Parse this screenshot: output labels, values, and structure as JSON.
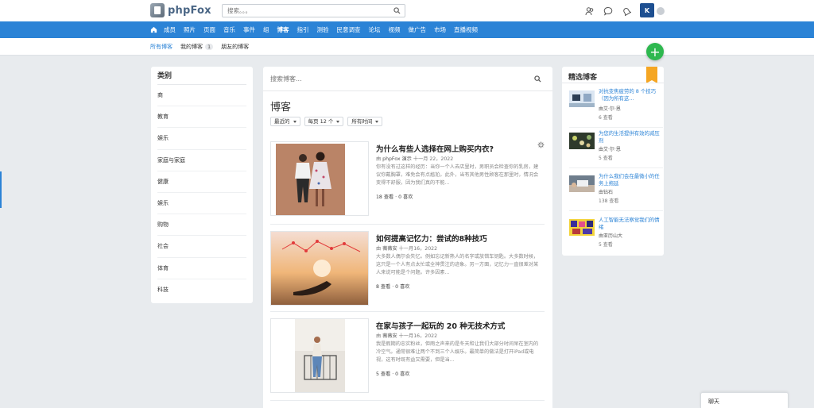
{
  "header": {
    "logo_text": "phpFox",
    "search_placeholder": "搜索。。。"
  },
  "nav": {
    "items": [
      "成员",
      "照片",
      "页面",
      "音乐",
      "事件",
      "组",
      "博客",
      "指引",
      "测验",
      "民意调查",
      "论坛",
      "视频",
      "做广告",
      "市场",
      "直播视频"
    ],
    "active_index": 6
  },
  "subtabs": {
    "all": "所有博客",
    "mine": "我的博客",
    "mine_count": "1",
    "friends": "朋友的博客"
  },
  "categories": {
    "title": "类别",
    "items": [
      "商",
      "教育",
      "娱乐",
      "家庭与家庭",
      "健康",
      "娱乐",
      "购物",
      "社会",
      "体育",
      "科技"
    ]
  },
  "main": {
    "search_placeholder": "搜索博客...",
    "title": "博客",
    "filters": [
      "最近的",
      "每页 12 个",
      "所有时间"
    ]
  },
  "posts": [
    {
      "title": "为什么有些人选择在网上购买内衣?",
      "author": "phpFox 演示",
      "date": "十一月 22，2022",
      "excerpt": "你有没有过这样的经历：当你一个人去店里时，男职员会检查你的乳房，建议你戴胸罩，难免会有点尴尬。此外，当有其他男性顾客在那里时，情况会变得不舒服，因为我们真的不能...",
      "stats": "18 查看 · 0 喜欢"
    },
    {
      "title": "如何提高记忆力：尝试的8种技巧",
      "author": "薇薇安",
      "date": "十一月16，2022",
      "excerpt": "大多数人偶尔会失忆。例如忘记新熟人的名字或放错车钥匙。大多数时候，这只是一个人有点太忙或全神贯注的迹象。另一方面，记忆力一直很差对某人来说可能是个问题。许多因素...",
      "stats": "8 查看 · 0 喜欢"
    },
    {
      "title": "在家与孩子一起玩的 20 种无技术方式",
      "author": "薇薇安",
      "date": "十一月16，2022",
      "excerpt": "我是假期的忠实粉丝，但雨之声来的是冬天和让我们大部分时间呆在室内的冷空气。通常很难让两个不到三个人娱乐。最简单的做法是打开iPad或电视，这有时既有益又需要，但是当...",
      "stats": "5 查看 · 0 喜欢"
    }
  ],
  "featured": {
    "title": "精选博客",
    "items": [
      {
        "title": "对抗变焦疲劳的 8 个技巧（因为所有这...",
        "author": "由艾·尔·恩",
        "views": "6 查看"
      },
      {
        "title": "为您的生活提供有效的减压剂",
        "author": "由艾·尔·恩",
        "views": "5 查看"
      },
      {
        "title": "为什么我们会在最微小的任务上拖延",
        "author": "由钻石",
        "views": "138 查看"
      },
      {
        "title": "人工智能无法察觉我们的情绪",
        "author": "由亚历山大",
        "views": "5 查看"
      }
    ]
  },
  "chat": {
    "label": "聊天"
  }
}
